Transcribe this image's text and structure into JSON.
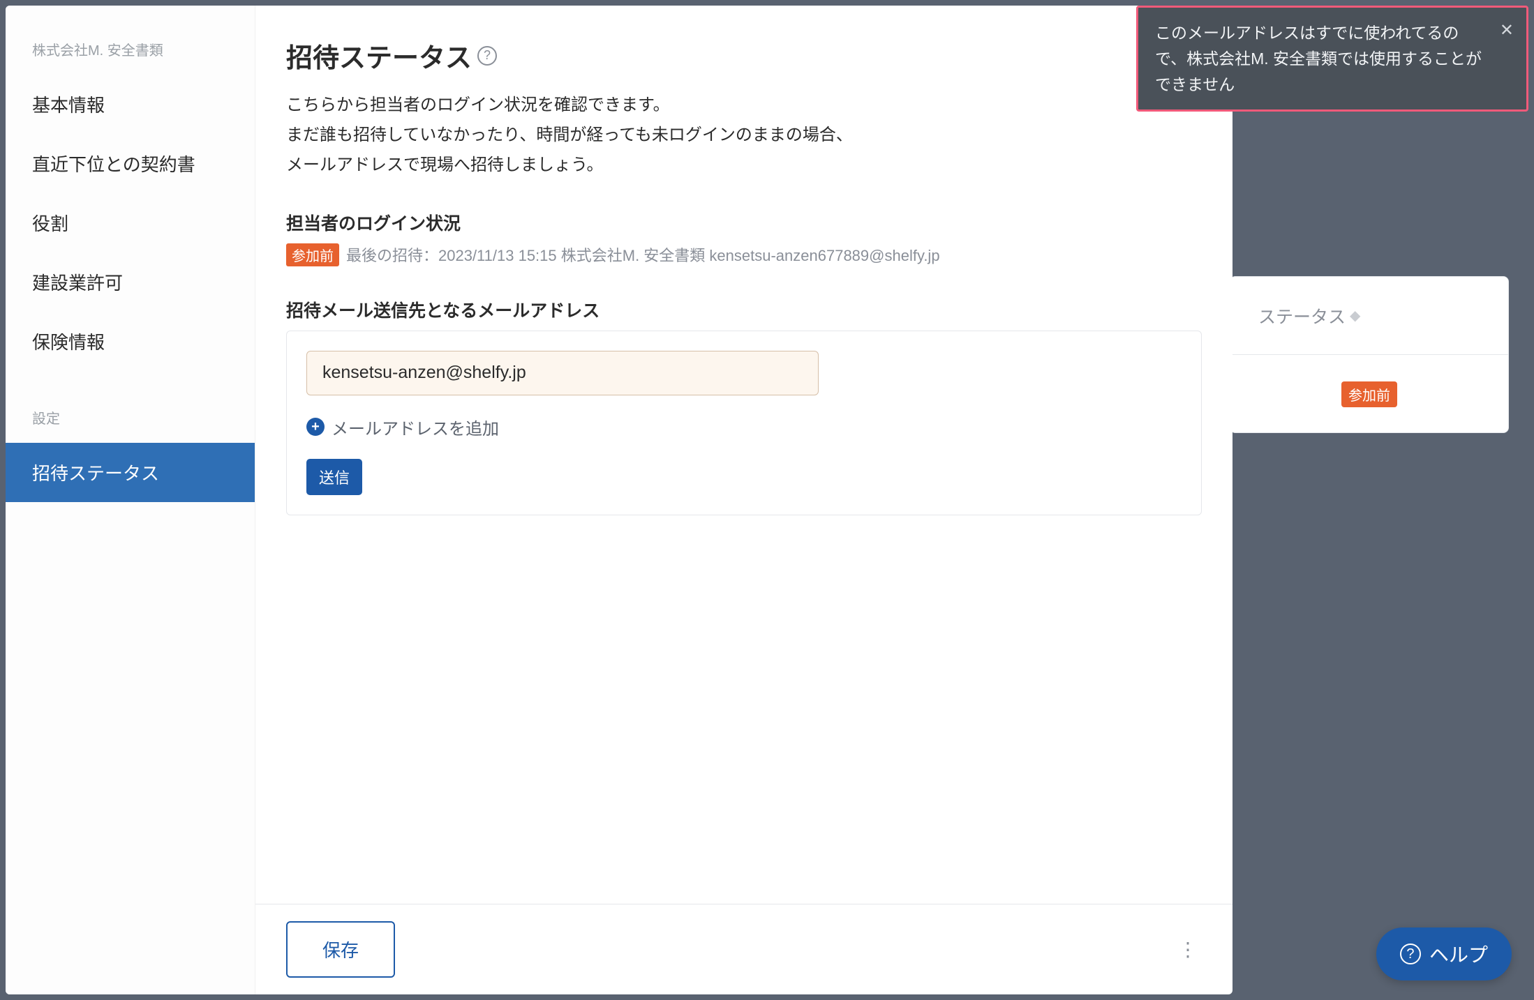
{
  "sidebar": {
    "group1_title": "株式会社M. 安全書類",
    "items1": [
      {
        "label": "基本情報"
      },
      {
        "label": "直近下位との契約書"
      },
      {
        "label": "役割"
      },
      {
        "label": "建設業許可"
      },
      {
        "label": "保険情報"
      }
    ],
    "group2_title": "設定",
    "items2": [
      {
        "label": "招待ステータス"
      }
    ]
  },
  "main": {
    "title": "招待ステータス",
    "description_line1": "こちらから担当者のログイン状況を確認できます。",
    "description_line2": "まだ誰も招待していなかったり、時間が経っても未ログインのままの場合、",
    "description_line3": "メールアドレスで現場へ招待しましょう。",
    "login_status_title": "担当者のログイン状況",
    "status_badge": "参加前",
    "status_text": "最後の招待：2023/11/13 15:15 株式会社M. 安全書類 kensetsu-anzen677889@shelfy.jp",
    "email_section_title": "招待メール送信先となるメールアドレス",
    "email_value": "kensetsu-anzen@shelfy.jp",
    "add_email_label": "メールアドレスを追加",
    "send_button": "送信",
    "save_button": "保存"
  },
  "toast": {
    "message": "このメールアドレスはすでに使われてるので、株式会社M. 安全書類では使用することができません"
  },
  "bg": {
    "status_col": "ステータス",
    "badge": "参加前"
  },
  "help_fab": "ヘルプ"
}
